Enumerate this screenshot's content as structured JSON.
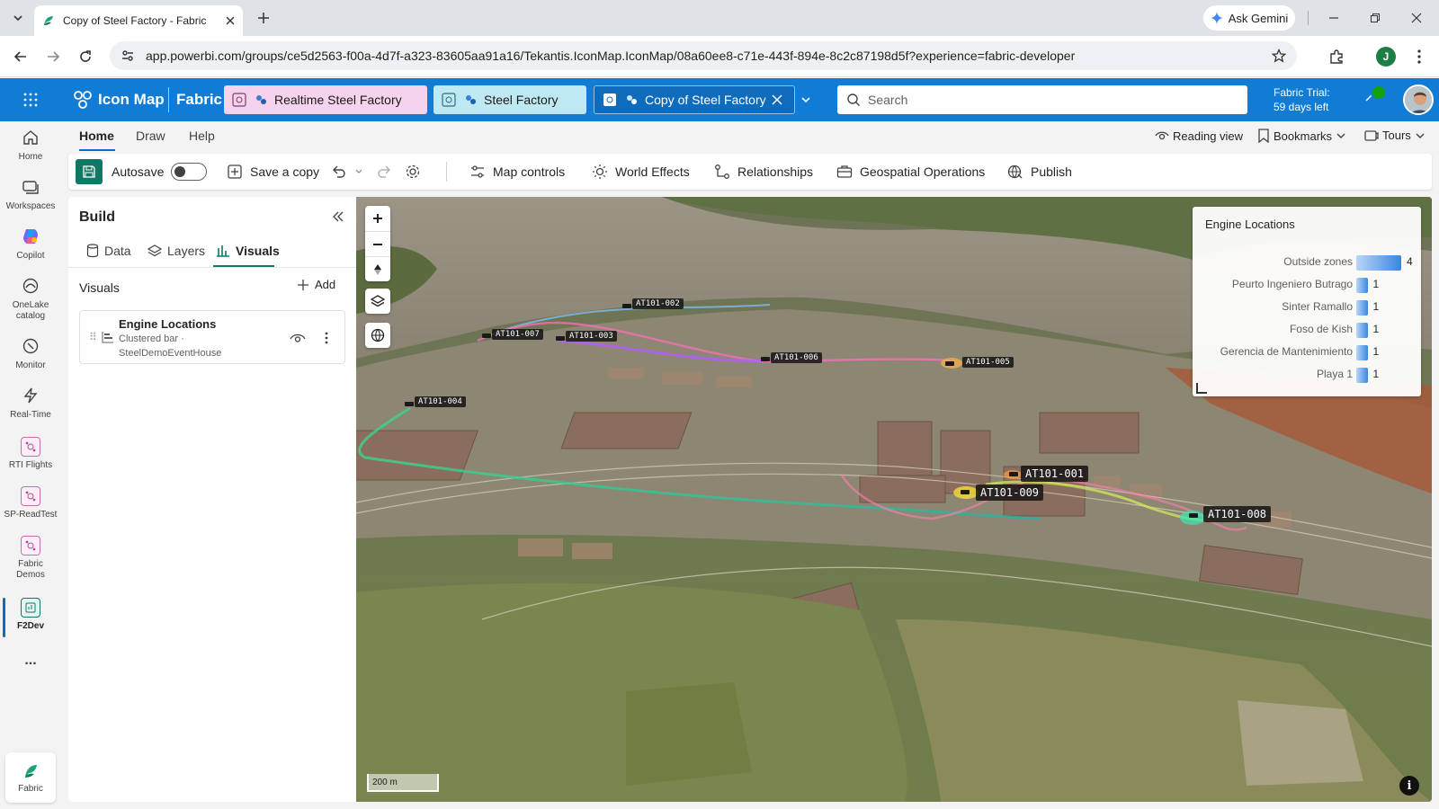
{
  "browser": {
    "tab_title": "Copy of Steel Factory - Fabric",
    "gemini_label": "Ask Gemini",
    "url": "app.powerbi.com/groups/ce5d2563-f00a-4d7f-a323-83605aa91a16/Tekantis.IconMap.IconMap/08a60ee8-c71e-443f-894e-8c2c87198d5f?experience=fabric-developer",
    "profile_initial": "J"
  },
  "appbar": {
    "app_name": "Icon Map",
    "fabric_label": "Fabric",
    "item_tabs": [
      {
        "label": "Realtime Steel Factory"
      },
      {
        "label": "Steel Factory"
      },
      {
        "label": "Copy of Steel Factory"
      }
    ],
    "search_placeholder": "Search",
    "trial_line1": "Fabric Trial:",
    "trial_line2": "59 days left"
  },
  "rail": {
    "items": [
      {
        "label": "Home",
        "icon": "home-icon"
      },
      {
        "label": "Workspaces",
        "icon": "workspaces-icon"
      },
      {
        "label": "Copilot",
        "icon": "copilot-icon"
      },
      {
        "label": "OneLake catalog",
        "icon": "onelake-icon"
      },
      {
        "label": "Monitor",
        "icon": "monitor-icon"
      },
      {
        "label": "Real-Time",
        "icon": "lightning-icon"
      },
      {
        "label": "RTI Flights",
        "icon": "workspace-icon"
      },
      {
        "label": "SP-ReadTest",
        "icon": "workspace-icon"
      },
      {
        "label": "Fabric Demos",
        "icon": "workspace-icon"
      },
      {
        "label": "F2Dev",
        "icon": "workspace-icon"
      }
    ],
    "more_label": "...",
    "bottom_label": "Fabric"
  },
  "ribbon": {
    "tabs": [
      "Home",
      "Draw",
      "Help"
    ],
    "reading_view": "Reading view",
    "bookmarks": "Bookmarks",
    "tours": "Tours",
    "autosave_label": "Autosave",
    "save_copy": "Save a copy",
    "map_controls": "Map controls",
    "world_effects": "World Effects",
    "relationships": "Relationships",
    "geospatial": "Geospatial Operations",
    "publish": "Publish"
  },
  "build": {
    "title": "Build",
    "tabs": [
      "Data",
      "Layers",
      "Visuals"
    ],
    "visuals_heading": "Visuals",
    "add_label": "Add",
    "card": {
      "title": "Engine Locations",
      "subtitle1": "Clustered bar ·",
      "subtitle2": "SteelDemoEventHouse"
    }
  },
  "map": {
    "scale_label": "200 m",
    "engine_labels": [
      "AT101-002",
      "AT101-007",
      "AT101-003",
      "AT101-006",
      "AT101-005",
      "AT101-004",
      "AT101-001",
      "AT101-009",
      "AT101-008"
    ]
  },
  "chart_data": {
    "type": "bar",
    "orientation": "horizontal",
    "title": "Engine Locations",
    "categories": [
      "Outside zones",
      "Peurto Ingeniero Butrago",
      "Sinter Ramallo",
      "Foso de Kish",
      "Gerencia de Mantenimiento",
      "Playa 1"
    ],
    "values": [
      4,
      1,
      1,
      1,
      1,
      1
    ],
    "xlim": [
      0,
      4
    ],
    "bar_color": "#3a86e0"
  },
  "colors": {
    "brand_blue": "#117cd6",
    "save_green": "#117865",
    "tab_realtime": "#f6d3ec",
    "tab_steel": "#bfe9f2"
  }
}
